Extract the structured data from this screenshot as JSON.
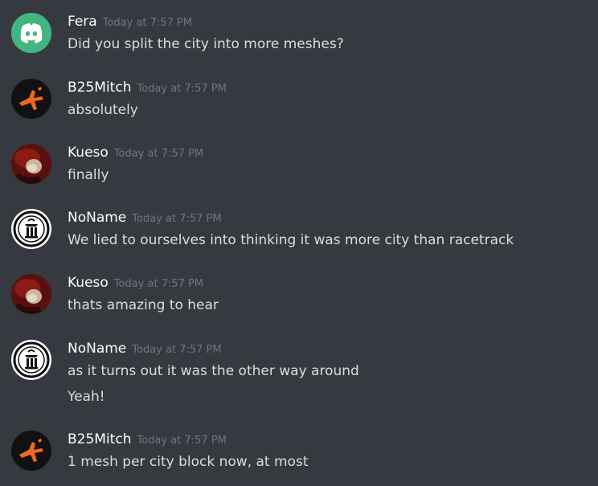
{
  "colors": {
    "background": "#36393f",
    "username": "#ffffff",
    "timestamp": "#72767d",
    "message_text": "#dcddde",
    "discord_blurple": "#43b581"
  },
  "messages": [
    {
      "username": "Fera",
      "timestamp": "Today at 7:57 PM",
      "avatar": "discord-logo-icon",
      "lines": [
        "Did you split the city into more meshes?"
      ]
    },
    {
      "username": "B25Mitch",
      "timestamp": "Today at 7:57 PM",
      "avatar": "plane-avatar",
      "lines": [
        "absolutely"
      ]
    },
    {
      "username": "Kueso",
      "timestamp": "Today at 7:57 PM",
      "avatar": "photo-avatar",
      "lines": [
        "finally"
      ]
    },
    {
      "username": "NoName",
      "timestamp": "Today at 7:57 PM",
      "avatar": "seal-avatar",
      "lines": [
        "We lied to ourselves into thinking it was more city than racetrack"
      ]
    },
    {
      "username": "Kueso",
      "timestamp": "Today at 7:57 PM",
      "avatar": "photo-avatar",
      "lines": [
        "thats amazing to hear"
      ]
    },
    {
      "username": "NoName",
      "timestamp": "Today at 7:57 PM",
      "avatar": "seal-avatar",
      "lines": [
        "as it turns out it was the other way around",
        "Yeah!"
      ]
    },
    {
      "username": "B25Mitch",
      "timestamp": "Today at 7:57 PM",
      "avatar": "plane-avatar",
      "lines": [
        "1 mesh per city block now, at most"
      ]
    }
  ]
}
